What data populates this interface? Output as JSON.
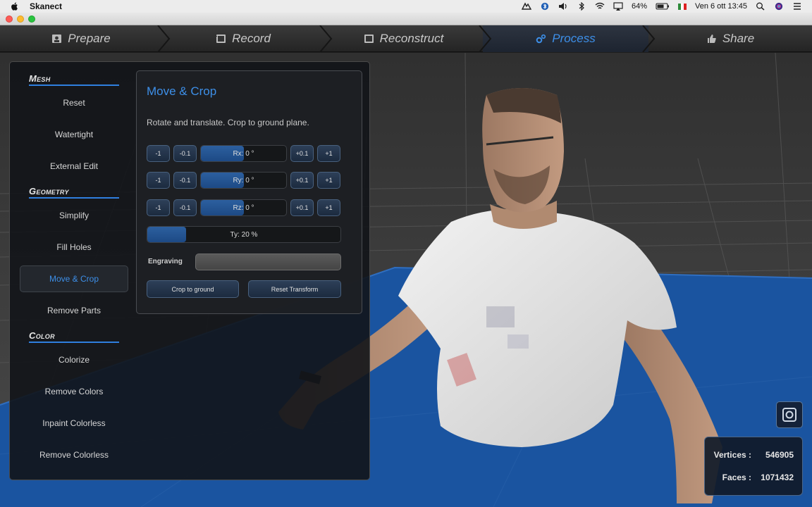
{
  "menubar": {
    "app_name": "Skanect",
    "battery": "64%",
    "clock": "Ven 6 ott  13:45",
    "icons": [
      "apple-icon",
      "bluetooth-icon",
      "volume-icon",
      "wifi-icon",
      "airplay-icon",
      "battery-icon",
      "flag-icon",
      "search-icon",
      "siri-icon",
      "menu-list-icon"
    ]
  },
  "tabs": [
    {
      "label": "Prepare",
      "icon": "prepare-icon"
    },
    {
      "label": "Record",
      "icon": "record-icon"
    },
    {
      "label": "Reconstruct",
      "icon": "reconstruct-icon"
    },
    {
      "label": "Process",
      "icon": "gears-icon",
      "active": true
    },
    {
      "label": "Share",
      "icon": "thumbs-up-icon"
    }
  ],
  "sidebar": {
    "mesh": {
      "header": "Mesh",
      "items": [
        "Reset",
        "Watertight",
        "External Edit"
      ]
    },
    "geometry": {
      "header": "Geometry",
      "items": [
        "Simplify",
        "Fill Holes",
        "Move & Crop",
        "Remove Parts"
      ]
    },
    "color": {
      "header": "Color",
      "items": [
        "Colorize",
        "Remove Colors",
        "Inpaint Colorless",
        "Remove Colorless"
      ]
    },
    "active_item": "Move & Crop"
  },
  "move_crop": {
    "title": "Move & Crop",
    "description": "Rotate and translate. Crop to ground plane.",
    "step_buttons": [
      "-1",
      "-0.1",
      "+0.1",
      "+1"
    ],
    "rotations": [
      {
        "label": "Rx: 0 °",
        "value_deg": 0
      },
      {
        "label": "Ry: 0 °",
        "value_deg": 0
      },
      {
        "label": "Rz: 0 °",
        "value_deg": 0
      }
    ],
    "ty": {
      "label": "Ty: 20 %",
      "value_pct": 20
    },
    "engraving_label": "Engraving",
    "engraving_value": "",
    "crop_button": "Crop to ground",
    "reset_button": "Reset Transform"
  },
  "stats": {
    "vertices_label": "Vertices :",
    "vertices_value": "546905",
    "faces_label": "Faces :",
    "faces_value": "1071432"
  },
  "colors": {
    "accent": "#3d8fe8",
    "ground_plane": "#1a54a0",
    "panel_bg": "#121418"
  }
}
